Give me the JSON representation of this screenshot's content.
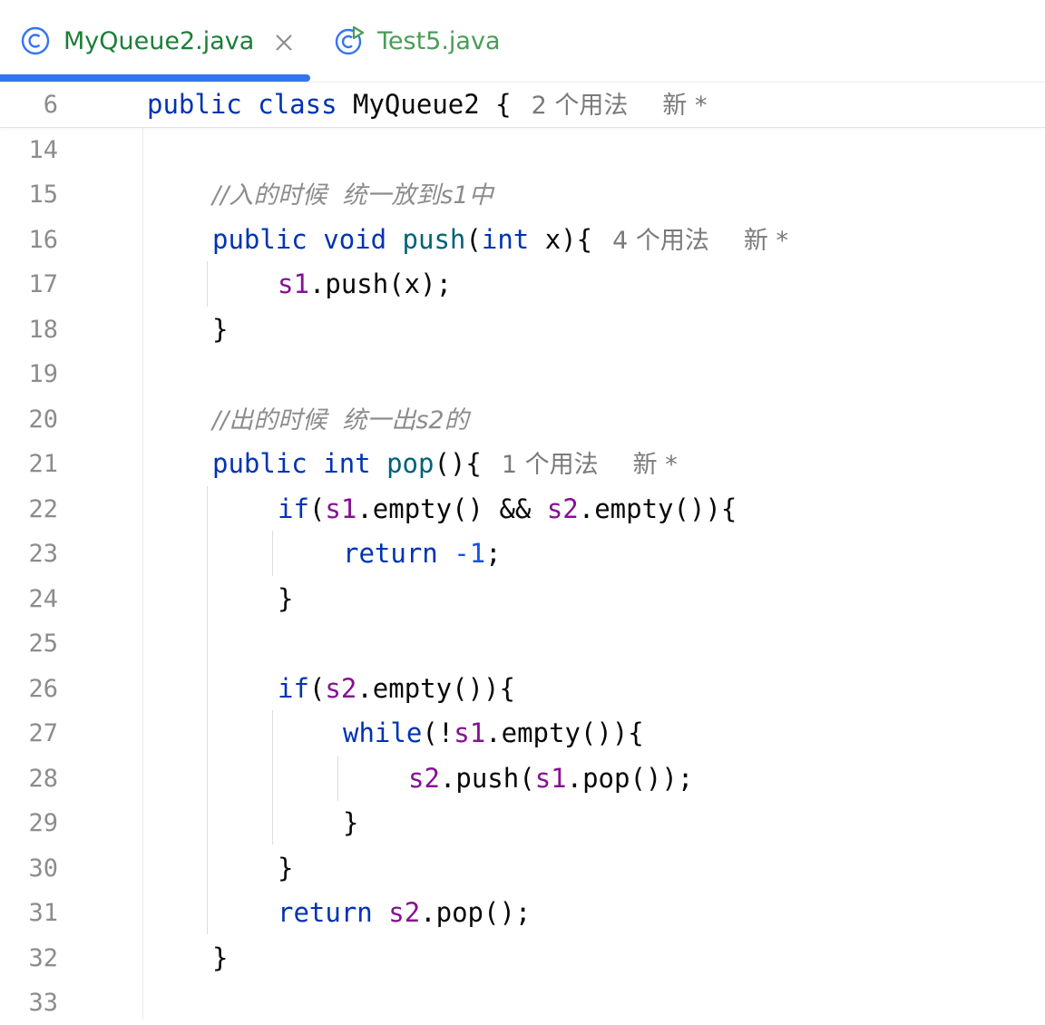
{
  "tabs": [
    {
      "label": "MyQueue2.java",
      "active": true,
      "icon": "class-icon"
    },
    {
      "label": "Test5.java",
      "active": false,
      "icon": "test-class-icon"
    }
  ],
  "sticky": {
    "line": "6",
    "kw1": "public",
    "kw2": "class",
    "name": "MyQueue2",
    "brace": "{",
    "usages": "2 个用法",
    "new": "新 *"
  },
  "lines": {
    "l14": "14",
    "l15": "15",
    "l16": "16",
    "l17": "17",
    "l18": "18",
    "l19": "19",
    "l20": "20",
    "l21": "21",
    "l22": "22",
    "l23": "23",
    "l24": "24",
    "l25": "25",
    "l26": "26",
    "l27": "27",
    "l28": "28",
    "l29": "29",
    "l30": "30",
    "l31": "31",
    "l32": "32",
    "l33": "33"
  },
  "code": {
    "c15_comment": "//入的时候  统一放到s1中",
    "c16_public": "public",
    "c16_void": "void",
    "c16_push": "push",
    "c16_paren": "(",
    "c16_int": "int",
    "c16_rest": " x){",
    "c16_usages": "4 个用法",
    "c16_new": "新 *",
    "c17_s1": "s1",
    "c17_rest": ".push(x);",
    "c18": "}",
    "c20_comment": "//出的时候  统一出s2的",
    "c21_public": "public",
    "c21_int": "int",
    "c21_pop": "pop",
    "c21_rest": "(){",
    "c21_usages": "1 个用法",
    "c21_new": "新 *",
    "c22_if": "if",
    "c22_p": "(",
    "c22_s1": "s1",
    "c22_m": ".empty() && ",
    "c22_s2": "s2",
    "c22_e": ".empty()){",
    "c23_return": "return",
    "c23_num": "-1",
    "c23_semi": ";",
    "c24": "}",
    "c26_if": "if",
    "c26_p": "(",
    "c26_s2": "s2",
    "c26_e": ".empty()){",
    "c27_while": "while",
    "c27_p": "(!",
    "c27_s1": "s1",
    "c27_e": ".empty()){",
    "c28_s2": "s2",
    "c28_m": ".push(",
    "c28_s1": "s1",
    "c28_e": ".pop());",
    "c29": "}",
    "c30": "}",
    "c31_return": "return",
    "c31_s2": "s2",
    "c31_e": ".pop();",
    "c32": "}"
  },
  "colors": {
    "keyword": "#0033b3",
    "method": "#00627a",
    "field": "#871094",
    "number": "#1750eb",
    "comment": "#8c8c8c",
    "active_tab": "#1a7f37",
    "tab_underline": "#3574f0"
  }
}
